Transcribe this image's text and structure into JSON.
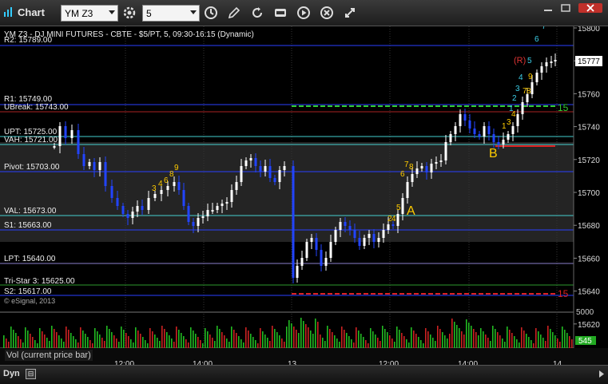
{
  "window": {
    "title": "Chart"
  },
  "toolbar": {
    "symbol": "YM Z3",
    "interval": "5"
  },
  "chart": {
    "header": "YM Z3 - DJ MINI FUTURES - CBTE - $5/PT, 5, 09:30-16:15 (Dynamic)",
    "copyright": "© eSignal, 2013",
    "current_price": "15777",
    "levels": {
      "r2": "R2: 15789.00",
      "r1": "R1: 15749.00",
      "ubreak": "UBreak: 15743.00",
      "upt": "UPT: 15725.00",
      "vah": "VAH: 15721.00",
      "pivot": "Pivot: 15703.00",
      "val": "VAL: 15673.00",
      "s1": "S1: 15663.00",
      "lpt": "LPT: 15640.00",
      "tristar": "Tri-Star 3: 15625.00",
      "s2": "S2: 15617.00"
    },
    "price_ticks": [
      "15800",
      "15780",
      "15760",
      "15740",
      "15720",
      "15700",
      "15680",
      "15660",
      "15640",
      "15620"
    ],
    "time_ticks": [
      "12:00",
      "14:00",
      "13",
      "12:00",
      "14:00",
      "14"
    ],
    "markers": {
      "a": "A",
      "b": "B",
      "r": "(R)",
      "right_15_top": "15",
      "right_15_bottom": "15"
    },
    "annotations": [
      "9",
      "3",
      "4",
      "5",
      "6",
      "7",
      "8",
      "9",
      "6",
      "7",
      "8",
      "5",
      "4",
      "3",
      "2",
      "1",
      "4",
      "5",
      "6",
      "7",
      "1",
      "2",
      "3",
      "4",
      "5",
      "6",
      "7",
      "8",
      "9"
    ],
    "colors": {
      "up_bar": "#ffffff",
      "down_bar": "#2244ff",
      "blue_line": "#2a3fff",
      "cyan_line": "#44d0d0",
      "green_dash": "#33cc33",
      "red_line": "#dd2222"
    }
  },
  "volume_panel": {
    "label": "Vol (current price bar)",
    "tick": "5000",
    "current": "545"
  },
  "bottom": {
    "mode": "Dyn"
  }
}
